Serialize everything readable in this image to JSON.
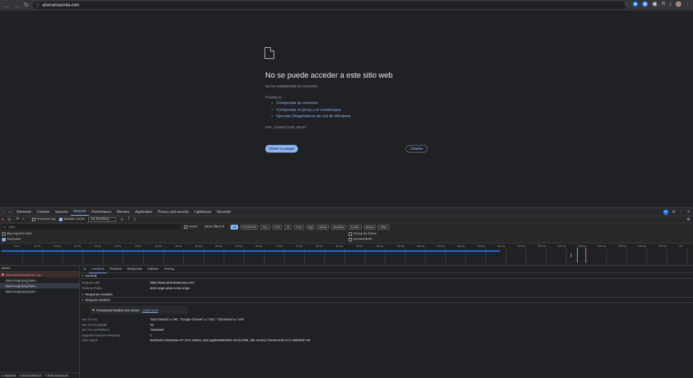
{
  "browser": {
    "url": "ahorramascota.com",
    "back_icon": "back-icon",
    "forward_icon": "forward-icon",
    "reload_icon": "reload-icon"
  },
  "error_page": {
    "title": "No se puede acceder a este sitio web",
    "subtitle": "Se ha restablecido la conexión.",
    "try_label": "Prueba a:",
    "suggestions": [
      "Comprobar la conexión",
      "Comprobar el proxy y el cortafuegos",
      "Ejecutar Diagnósticos de red de Windows"
    ],
    "error_code": "ERR_CONNECTION_RESET",
    "reload_label": "Volver a cargar",
    "details_label": "Detalles"
  },
  "devtools": {
    "tabs": [
      "Elements",
      "Console",
      "Sources",
      "Network",
      "Performance",
      "Memory",
      "Application",
      "Privacy and security",
      "Lighthouse",
      "Recorder"
    ],
    "active_tab": "Network",
    "toolbar": {
      "preserve_log": "Preserve log",
      "disable_cache": "Disable cache",
      "throttling": "No throttling"
    },
    "filter": {
      "placeholder": "Filter",
      "invert": "Invert",
      "more_filters": "More filters",
      "chips": [
        "All",
        "Fetch/XHR",
        "Doc",
        "CSS",
        "JS",
        "Font",
        "Img",
        "Media",
        "Manifest",
        "Socket",
        "Wasm",
        "Other"
      ]
    },
    "options": {
      "big_rows": "Big request rows",
      "overview": "Overview",
      "group_by_frame": "Group by frame",
      "screenshots": "Screenshots"
    },
    "timeline_ticks": [
      "5 ms",
      "10 ms",
      "15 ms",
      "20 ms",
      "25 ms",
      "30 ms",
      "35 ms",
      "40 ms",
      "45 ms",
      "50 ms",
      "55 ms",
      "60 ms",
      "65 ms",
      "70 ms",
      "75 ms",
      "80 ms",
      "85 ms",
      "90 ms",
      "95 ms",
      "100 ms",
      "105 ms",
      "110 ms",
      "115 ms",
      "120 ms",
      "125 ms",
      "130 ms",
      "135 ms",
      "140 ms",
      "145 ms",
      "150 ms",
      "155 ms",
      "160 ms",
      "165 ms",
      "170"
    ],
    "requests": {
      "header": "Name",
      "items": [
        "www.ahorramascota.com",
        "data:image/png;base...",
        "data:image/png;base...",
        "data:image/png;base..."
      ],
      "status": [
        "4 requests",
        "0 B transferred",
        "7.9 kB resources"
      ]
    },
    "detail": {
      "tabs": [
        "Headers",
        "Preview",
        "Response",
        "Initiator",
        "Timing"
      ],
      "general_title": "General",
      "general": [
        {
          "k": "Request URL",
          "v": "https://www.ahorramascota.com/"
        },
        {
          "k": "Referrer Policy",
          "v": "strict-origin-when-cross-origin"
        }
      ],
      "response_headers_title": "Response Headers",
      "request_headers_title": "Request Headers",
      "warning_text": "Provisional headers are shown.",
      "warning_link": "Learn more",
      "request_headers": [
        {
          "k": "Sec-Ch-Ua",
          "v": "\"Not A Brand\";v=\"99\", \"Google Chrome\";v=\"145\", \"Chromium\";v=\"145\""
        },
        {
          "k": "Sec-Ch-Ua-Mobile",
          "v": "?0"
        },
        {
          "k": "Sec-Ch-Ua-Platform",
          "v": "\"Windows\""
        },
        {
          "k": "Upgrade-Insecure-Requests",
          "v": "1"
        },
        {
          "k": "User-Agent",
          "v": "Mozilla/5.0 (Windows NT 10.0; Win64; x64) AppleWebKit/537.36 (KHTML, like Gecko) Chrome/145.0.0.0 Safari/537.36"
        }
      ]
    }
  }
}
